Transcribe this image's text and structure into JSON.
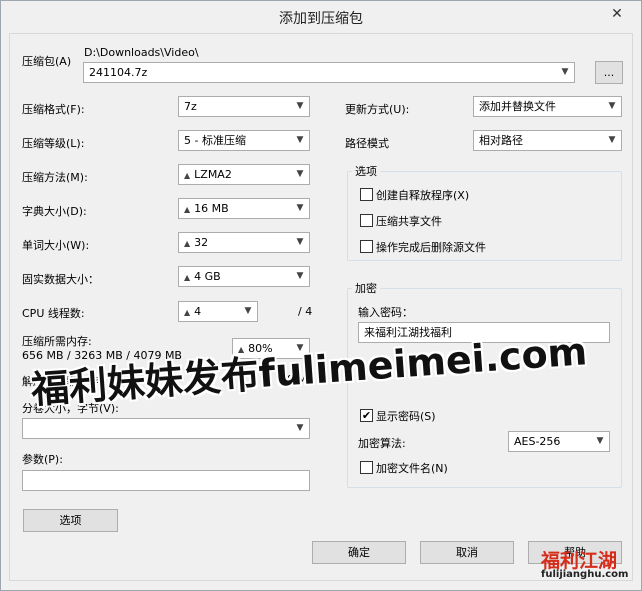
{
  "window": {
    "title": "添加到压缩包",
    "close_glyph": "✕"
  },
  "archive": {
    "label": "压缩包(A)",
    "path": "D:\\Downloads\\Video\\",
    "name": "241104.7z",
    "browse_label": "..."
  },
  "left": {
    "format": {
      "label": "压缩格式(F):",
      "value": "7z"
    },
    "level": {
      "label": "压缩等级(L):",
      "value": "5 - 标准压缩"
    },
    "method": {
      "label": "压缩方法(M):",
      "value": "LZMA2"
    },
    "dict": {
      "label": "字典大小(D):",
      "value": "16 MB"
    },
    "word": {
      "label": "单词大小(W):",
      "value": "32"
    },
    "solid": {
      "label": "固实数据大小：",
      "value": "4 GB"
    },
    "threads": {
      "label": "CPU 线程数:",
      "value": "4",
      "total": "/ 4"
    },
    "mem_compress": {
      "label": "压缩所需内存:",
      "detail": "656 MB / 3263 MB / 4079 MB",
      "value": "80%"
    },
    "mem_decompress": {
      "label": "解压缩所需内存:",
      "value": "18 MB"
    },
    "split": {
      "label": "分卷大小，字节(V):",
      "value": ""
    },
    "params": {
      "label": "参数(P):",
      "value": ""
    },
    "options_button": "选项"
  },
  "right": {
    "update": {
      "label": "更新方式(U):",
      "value": "添加并替换文件"
    },
    "path_mode": {
      "label": "路径模式",
      "value": "相对路径"
    },
    "options_group": {
      "title": "选项",
      "items": [
        {
          "label": "创建自释放程序(X)",
          "checked": false
        },
        {
          "label": "压缩共享文件",
          "checked": false
        },
        {
          "label": "操作完成后删除源文件",
          "checked": false
        }
      ]
    },
    "encryption": {
      "title": "加密",
      "password_label": "输入密码：",
      "password_value": "来福利江湖找福利",
      "show_password": {
        "label": "显示密码(S)",
        "checked": true
      },
      "method_label": "加密算法:",
      "method_value": "AES-256",
      "encrypt_names": {
        "label": "加密文件名(N)",
        "checked": false
      }
    }
  },
  "buttons": {
    "ok": "确定",
    "cancel": "取消",
    "help": "帮助"
  },
  "overlay": {
    "watermark": "福利妹妹发布fulimeimei.com",
    "logo_line1": "福利江湖",
    "logo_line2": "fulijianghu.com"
  },
  "icons": {
    "dropdown": "dropdown-arrow-icon",
    "spin": "spin-arrow-icon",
    "check": "checkmark-icon"
  }
}
